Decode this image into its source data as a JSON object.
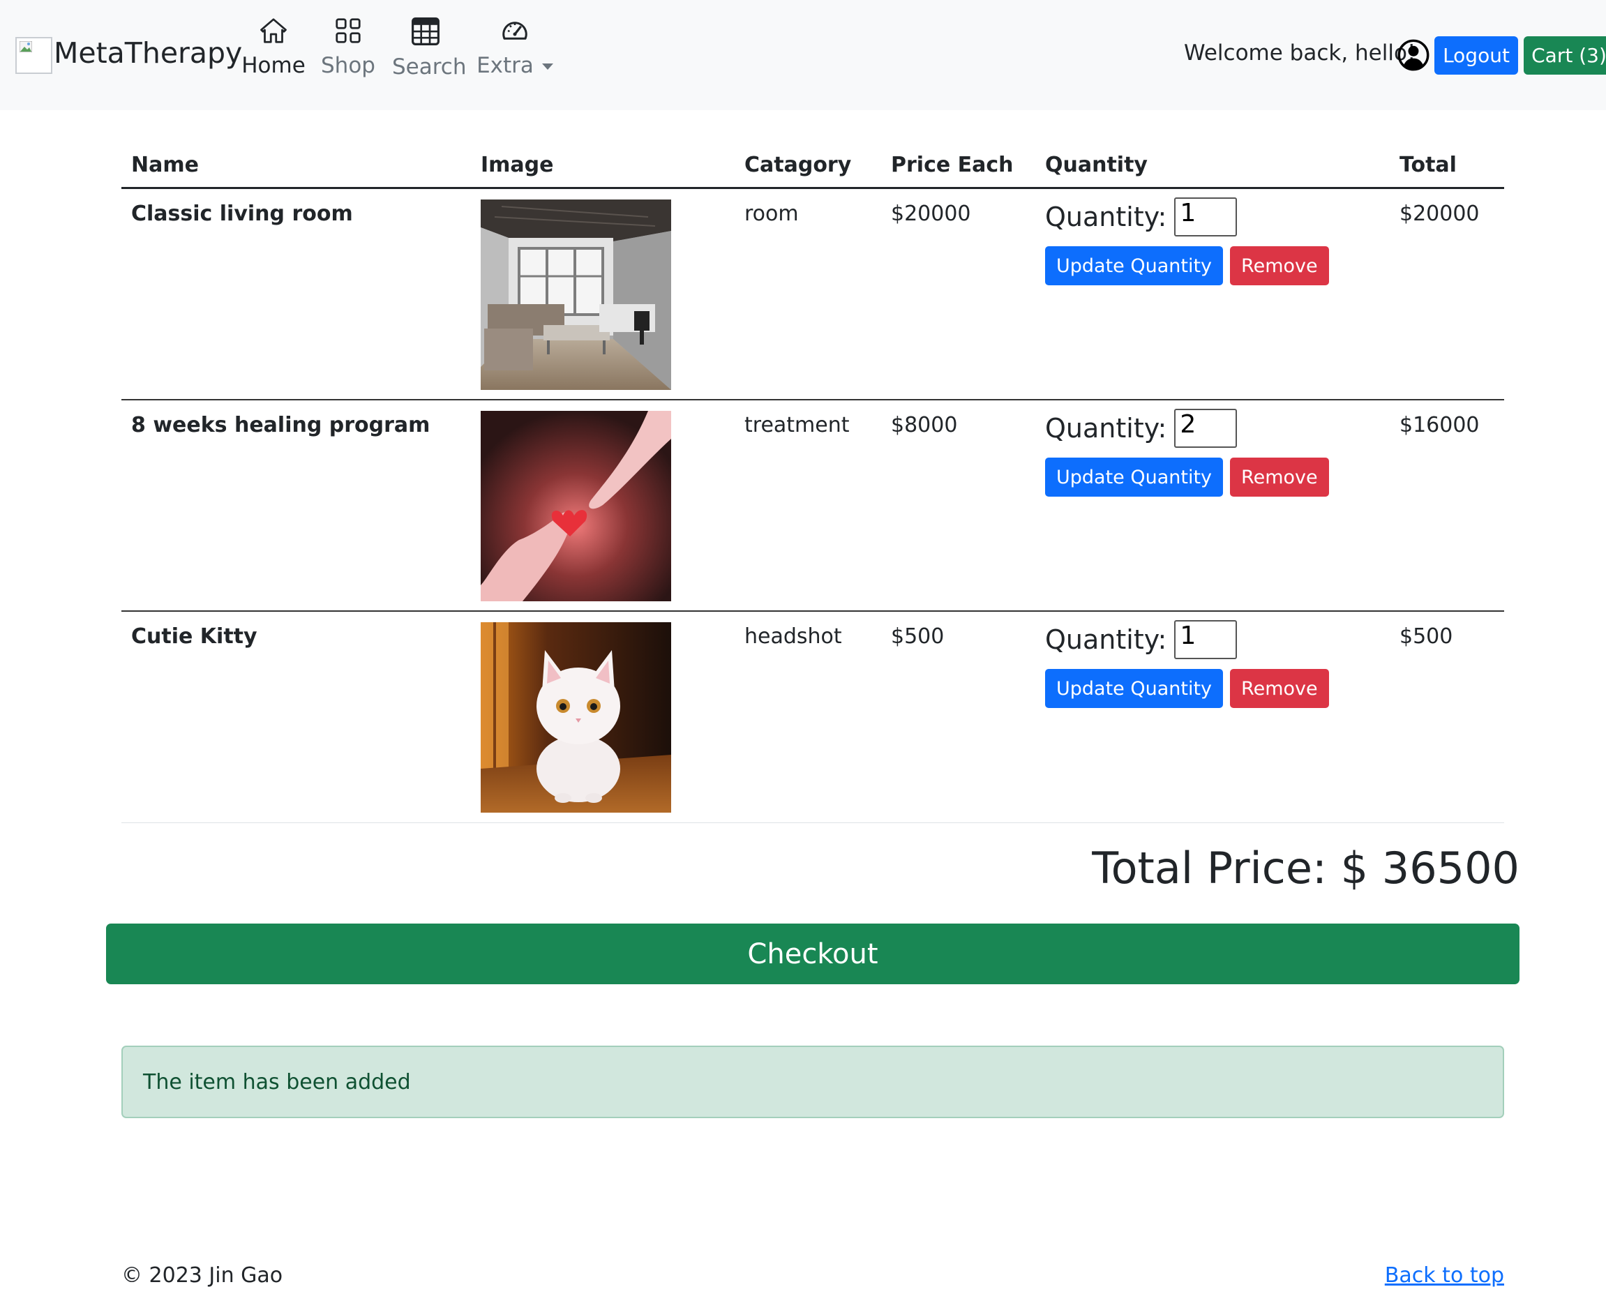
{
  "navbar": {
    "brand": "MetaTherapy",
    "items": [
      {
        "label": "Home",
        "icon": "house-icon",
        "active": true
      },
      {
        "label": "Shop",
        "icon": "grid-icon",
        "active": false
      },
      {
        "label": "Search",
        "icon": "table-icon",
        "active": false
      },
      {
        "label": "Extra",
        "icon": "speedometer-icon",
        "active": false
      }
    ],
    "welcome": "Welcome back, hello!",
    "logout_label": "Logout",
    "cart_label": "Cart (3)"
  },
  "table": {
    "headers": [
      "Name",
      "Image",
      "Catagory",
      "Price Each",
      "Quantity",
      "Total"
    ],
    "rows": [
      {
        "name": "Classic living room",
        "category": "room",
        "price": "$20000",
        "quantity_label": "Quantity:",
        "quantity": "1",
        "total": "$20000",
        "image": "living-room-image"
      },
      {
        "name": "8 weeks healing program",
        "category": "treatment",
        "price": "$8000",
        "quantity_label": "Quantity:",
        "quantity": "2",
        "total": "$16000",
        "image": "hands-heart-image"
      },
      {
        "name": "Cutie Kitty",
        "category": "headshot",
        "price": "$500",
        "quantity_label": "Quantity:",
        "quantity": "1",
        "total": "$500",
        "image": "white-kitten-image"
      }
    ],
    "update_label": "Update Quantity",
    "remove_label": "Remove"
  },
  "total_price": "Total Price: $ 36500",
  "checkout_label": "Checkout",
  "alert": "The item has been added",
  "footer": {
    "copyright": "© 2023 Jin Gao",
    "back_to_top": "Back to top"
  },
  "colors": {
    "primary": "#0d6efd",
    "success": "#198754",
    "danger": "#dc3545",
    "navbar_bg": "#f8f9fa",
    "alert_bg": "#d1e7dd"
  }
}
